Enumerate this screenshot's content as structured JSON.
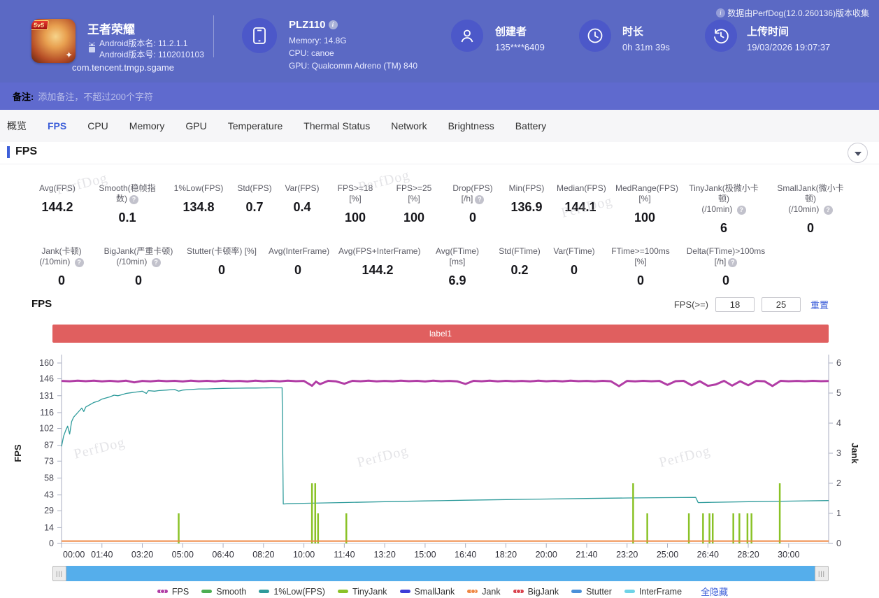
{
  "header": {
    "collect_note": "数据由PerfDog(12.0.260136)版本收集",
    "game": {
      "title": "王者荣耀",
      "badge": "5v5",
      "version_name": "Android版本名: 11.2.1.1",
      "version_code": "Android版本号: 1102010103",
      "package": "com.tencent.tmgp.sgame"
    },
    "device": {
      "model": "PLZ110",
      "memory": "Memory: 14.8G",
      "cpu": "CPU: canoe",
      "gpu": "GPU: Qualcomm Adreno (TM) 840"
    },
    "creator": {
      "label": "创建者",
      "value": "135****6409"
    },
    "duration": {
      "label": "时长",
      "value": "0h 31m 39s"
    },
    "upload": {
      "label": "上传时间",
      "value": "19/03/2026 19:07:37"
    }
  },
  "note_bar": {
    "label": "备注:",
    "placeholder": "添加备注，不超过200个字符"
  },
  "tabs": {
    "active_index": 1,
    "items": [
      "概览",
      "FPS",
      "CPU",
      "Memory",
      "GPU",
      "Temperature",
      "Thermal Status",
      "Network",
      "Brightness",
      "Battery"
    ]
  },
  "section": {
    "title": "FPS"
  },
  "stats_row1": [
    {
      "label": "Avg(FPS)",
      "sub": "",
      "help": false,
      "value": "144.2"
    },
    {
      "label": "Smooth(稳帧指数)",
      "sub": "",
      "help": true,
      "value": "0.1"
    },
    {
      "label": "1%Low(FPS)",
      "sub": "",
      "help": false,
      "value": "134.8"
    },
    {
      "label": "Std(FPS)",
      "sub": "",
      "help": false,
      "value": "0.7"
    },
    {
      "label": "Var(FPS)",
      "sub": "",
      "help": false,
      "value": "0.4"
    },
    {
      "label": "FPS>=18 [%]",
      "sub": "",
      "help": false,
      "value": "100"
    },
    {
      "label": "FPS>=25 [%]",
      "sub": "",
      "help": false,
      "value": "100"
    },
    {
      "label": "Drop(FPS) [/h]",
      "sub": "",
      "help": true,
      "value": "0"
    },
    {
      "label": "Min(FPS)",
      "sub": "",
      "help": false,
      "value": "136.9"
    },
    {
      "label": "Median(FPS)",
      "sub": "",
      "help": false,
      "value": "144.1"
    },
    {
      "label": "MedRange(FPS)[%]",
      "sub": "",
      "help": false,
      "value": "100"
    },
    {
      "label": "TinyJank(极微小卡顿)",
      "sub": "(/10min)",
      "help": true,
      "value": "6"
    },
    {
      "label": "SmallJank(微小卡顿)",
      "sub": "(/10min)",
      "help": true,
      "value": "0"
    }
  ],
  "stats_row2": [
    {
      "label": "Jank(卡顿)",
      "sub": "(/10min)",
      "help": true,
      "value": "0"
    },
    {
      "label": "BigJank(严重卡顿)",
      "sub": "(/10min)",
      "help": true,
      "value": "0"
    },
    {
      "label": "Stutter(卡顿率) [%]",
      "sub": "",
      "help": false,
      "value": "0"
    },
    {
      "label": "Avg(InterFrame)",
      "sub": "",
      "help": false,
      "value": "0"
    },
    {
      "label": "Avg(FPS+InterFrame)",
      "sub": "",
      "help": false,
      "value": "144.2"
    },
    {
      "label": "Avg(FTime) [ms]",
      "sub": "",
      "help": false,
      "value": "6.9"
    },
    {
      "label": "Std(FTime)",
      "sub": "",
      "help": false,
      "value": "0.2"
    },
    {
      "label": "Var(FTime)",
      "sub": "",
      "help": false,
      "value": "0"
    },
    {
      "label": "FTime>=100ms [%]",
      "sub": "",
      "help": false,
      "value": "0"
    },
    {
      "label": "Delta(FTime)>100ms [/h]",
      "sub": "",
      "help": true,
      "value": "0"
    }
  ],
  "chart": {
    "title": "FPS",
    "controls": {
      "fps_ge_label": "FPS(>=)",
      "threshold1": "18",
      "threshold2": "25",
      "reset_label": "重置"
    },
    "hide_all_label": "全隐藏",
    "watermark": "PerfDog",
    "legend": [
      {
        "name": "FPS",
        "color": "#b13da5",
        "dot": true
      },
      {
        "name": "Smooth",
        "color": "#4cae52",
        "dot": false
      },
      {
        "name": "1%Low(FPS)",
        "color": "#2e9b9b",
        "dot": false
      },
      {
        "name": "TinyJank",
        "color": "#8ac227",
        "dot": false
      },
      {
        "name": "SmallJank",
        "color": "#3d3dd8",
        "dot": false
      },
      {
        "name": "Jank",
        "color": "#ef8742",
        "dot": true
      },
      {
        "name": "BigJank",
        "color": "#d9434e",
        "dot": true
      },
      {
        "name": "Stutter",
        "color": "#4a90d9",
        "dot": false
      },
      {
        "name": "InterFrame",
        "color": "#6fd3e7",
        "dot": false
      }
    ]
  },
  "chart_data": {
    "type": "line",
    "title": "FPS",
    "annotation_bar": {
      "label": "label1",
      "color": "#e05f5f"
    },
    "x_axis": {
      "unit": "mm:ss",
      "max_seconds": 1899,
      "tick_seconds": [
        0,
        100,
        200,
        300,
        400,
        500,
        600,
        700,
        800,
        900,
        1000,
        1100,
        1200,
        1300,
        1400,
        1500,
        1600,
        1700,
        1800
      ],
      "tick_labels": [
        "00:00",
        "01:40",
        "03:20",
        "05:00",
        "06:40",
        "08:20",
        "10:00",
        "11:40",
        "13:20",
        "15:00",
        "16:40",
        "18:20",
        "20:00",
        "21:40",
        "23:20",
        "25:00",
        "26:40",
        "28:20",
        "30:00"
      ]
    },
    "y_left": {
      "label": "FPS",
      "range": [
        0,
        160
      ],
      "ticks": [
        160,
        146,
        131,
        116,
        102,
        87,
        73,
        58,
        43,
        29,
        14,
        0
      ]
    },
    "y_right": {
      "label": "Jank",
      "range": [
        0,
        6
      ],
      "ticks": [
        6,
        5,
        4,
        3,
        2,
        1,
        0
      ]
    },
    "series": [
      {
        "name": "FPS",
        "axis": "left",
        "draw": "line",
        "color": "#b13da5",
        "width": 3,
        "points": [
          [
            0,
            144.1
          ],
          [
            20,
            143.8
          ],
          [
            40,
            144.3
          ],
          [
            60,
            143.9
          ],
          [
            80,
            144.4
          ],
          [
            100,
            143.7
          ],
          [
            120,
            144.2
          ],
          [
            140,
            143.6
          ],
          [
            160,
            144.3
          ],
          [
            180,
            142.8
          ],
          [
            200,
            144.1
          ],
          [
            220,
            143.7
          ],
          [
            240,
            144.3
          ],
          [
            260,
            143.9
          ],
          [
            280,
            144.2
          ],
          [
            300,
            143.6
          ],
          [
            320,
            144.4
          ],
          [
            340,
            143.8
          ],
          [
            360,
            144.2
          ],
          [
            380,
            143.7
          ],
          [
            400,
            144.3
          ],
          [
            420,
            143.9
          ],
          [
            440,
            144.1
          ],
          [
            460,
            143.6
          ],
          [
            480,
            144.3
          ],
          [
            500,
            143.8
          ],
          [
            520,
            144.2
          ],
          [
            540,
            143.7
          ],
          [
            560,
            144.3
          ],
          [
            580,
            143.9
          ],
          [
            600,
            144.1
          ],
          [
            620,
            139.8
          ],
          [
            630,
            143.5
          ],
          [
            640,
            141.2
          ],
          [
            660,
            144.2
          ],
          [
            680,
            143.7
          ],
          [
            700,
            141.6
          ],
          [
            720,
            144.2
          ],
          [
            740,
            143.8
          ],
          [
            760,
            144.3
          ],
          [
            780,
            143.7
          ],
          [
            800,
            144.1
          ],
          [
            820,
            143.8
          ],
          [
            840,
            144.3
          ],
          [
            860,
            143.9
          ],
          [
            880,
            144.2
          ],
          [
            900,
            143.6
          ],
          [
            920,
            144.3
          ],
          [
            940,
            143.8
          ],
          [
            960,
            144.1
          ],
          [
            980,
            143.7
          ],
          [
            1000,
            141.4
          ],
          [
            1020,
            144.2
          ],
          [
            1040,
            143.8
          ],
          [
            1060,
            144.3
          ],
          [
            1080,
            143.7
          ],
          [
            1100,
            144.2
          ],
          [
            1120,
            143.8
          ],
          [
            1140,
            144.1
          ],
          [
            1160,
            143.7
          ],
          [
            1180,
            144.3
          ],
          [
            1200,
            143.8
          ],
          [
            1220,
            144.2
          ],
          [
            1240,
            143.7
          ],
          [
            1260,
            144.3
          ],
          [
            1280,
            143.9
          ],
          [
            1300,
            144.1
          ],
          [
            1320,
            143.7
          ],
          [
            1340,
            144.2
          ],
          [
            1360,
            143.8
          ],
          [
            1380,
            139.5
          ],
          [
            1400,
            144.1
          ],
          [
            1420,
            143.7
          ],
          [
            1440,
            144.2
          ],
          [
            1460,
            143.8
          ],
          [
            1480,
            144.1
          ],
          [
            1500,
            140.6
          ],
          [
            1520,
            143.9
          ],
          [
            1540,
            144.2
          ],
          [
            1560,
            140.2
          ],
          [
            1580,
            143.8
          ],
          [
            1600,
            139.7
          ],
          [
            1620,
            141.0
          ],
          [
            1640,
            144.2
          ],
          [
            1660,
            139.9
          ],
          [
            1680,
            143.8
          ],
          [
            1700,
            140.3
          ],
          [
            1720,
            144.1
          ],
          [
            1740,
            143.8
          ],
          [
            1760,
            139.6
          ],
          [
            1780,
            144.2
          ],
          [
            1800,
            143.8
          ],
          [
            1820,
            144.1
          ],
          [
            1840,
            143.8
          ],
          [
            1860,
            144.2
          ],
          [
            1880,
            143.9
          ],
          [
            1899,
            144.0
          ]
        ]
      },
      {
        "name": "1%Low(FPS)",
        "axis": "left",
        "draw": "line",
        "color": "#2e9b9b",
        "width": 1.3,
        "points": [
          [
            0,
            86
          ],
          [
            5,
            95
          ],
          [
            10,
            100
          ],
          [
            15,
            104
          ],
          [
            20,
            97
          ],
          [
            25,
            108
          ],
          [
            30,
            112
          ],
          [
            40,
            116
          ],
          [
            50,
            120
          ],
          [
            55,
            117
          ],
          [
            60,
            121
          ],
          [
            70,
            123
          ],
          [
            80,
            125
          ],
          [
            90,
            126
          ],
          [
            100,
            128
          ],
          [
            110,
            129
          ],
          [
            120,
            130
          ],
          [
            130,
            131.5
          ],
          [
            140,
            131
          ],
          [
            150,
            132
          ],
          [
            160,
            133
          ],
          [
            170,
            133.5
          ],
          [
            180,
            134
          ],
          [
            190,
            134.5
          ],
          [
            200,
            135
          ],
          [
            210,
            133
          ],
          [
            215,
            135.5
          ],
          [
            230,
            135
          ],
          [
            240,
            135.5
          ],
          [
            260,
            136
          ],
          [
            280,
            136.5
          ],
          [
            290,
            135
          ],
          [
            300,
            136
          ],
          [
            320,
            136.5
          ],
          [
            340,
            137
          ],
          [
            360,
            137
          ],
          [
            380,
            137.3
          ],
          [
            400,
            137.5
          ],
          [
            420,
            137.6
          ],
          [
            440,
            137.7
          ],
          [
            460,
            137.8
          ],
          [
            480,
            137.8
          ],
          [
            500,
            137.9
          ],
          [
            520,
            138
          ],
          [
            540,
            138
          ],
          [
            546,
            138
          ],
          [
            549,
            35
          ],
          [
            560,
            35.2
          ],
          [
            600,
            35.6
          ],
          [
            700,
            36.3
          ],
          [
            800,
            37
          ],
          [
            900,
            37.7
          ],
          [
            1000,
            38.3
          ],
          [
            1100,
            38.9
          ],
          [
            1200,
            39.4
          ],
          [
            1300,
            39.9
          ],
          [
            1400,
            40.3
          ],
          [
            1500,
            40.6
          ],
          [
            1570,
            40.8
          ],
          [
            1576,
            36.2
          ],
          [
            1600,
            36.4
          ],
          [
            1700,
            37
          ],
          [
            1800,
            37.5
          ],
          [
            1899,
            38
          ]
        ]
      },
      {
        "name": "TinyJank",
        "axis": "right",
        "draw": "spike",
        "color": "#8ac227",
        "width": 2.5,
        "points": [
          [
            290,
            1
          ],
          [
            620,
            2
          ],
          [
            628,
            2
          ],
          [
            635,
            1
          ],
          [
            705,
            1
          ],
          [
            1415,
            2
          ],
          [
            1450,
            1
          ],
          [
            1553,
            1
          ],
          [
            1588,
            1
          ],
          [
            1604,
            1
          ],
          [
            1612,
            1
          ],
          [
            1663,
            1
          ],
          [
            1678,
            1
          ],
          [
            1698,
            1
          ],
          [
            1708,
            1
          ],
          [
            1778,
            2
          ]
        ]
      },
      {
        "name": "Jank",
        "axis": "right",
        "draw": "line",
        "color": "#ef8742",
        "width": 2,
        "points": [
          [
            0,
            0.08
          ],
          [
            1899,
            0.08
          ]
        ]
      }
    ]
  }
}
